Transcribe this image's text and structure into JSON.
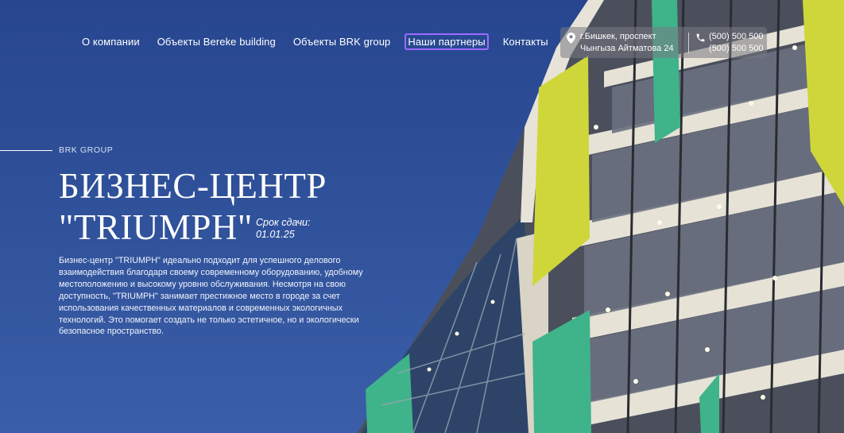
{
  "nav": {
    "items": [
      {
        "label": "О компании"
      },
      {
        "label": "Объекты Bereke building"
      },
      {
        "label": "Объекты BRK group"
      },
      {
        "label": "Наши партнеры"
      },
      {
        "label": "Контакты"
      }
    ],
    "active_index": 3
  },
  "contact": {
    "address_line1": "г.Бишкек, проспект",
    "address_line2": "Чынгыза Айтматова 24",
    "phone1": "(500) 500 500",
    "phone2": "(500) 500 500",
    "address_icon": "map-pin-icon",
    "phone_icon": "phone-icon"
  },
  "hero": {
    "kicker": "BRK GROUP",
    "title_line1": "БИЗНЕС-ЦЕНТР",
    "title_line2": "\"TRIUMPH\"",
    "deadline_label": "Срок сдачи:",
    "deadline_date": "01.01.25",
    "description": "Бизнес-центр \"TRIUMPH\" идеально подходит для успешного делового взаимодействия благодаря своему современному оборудованию, удобному местоположению и высокому уровню обслуживания. Несмотря на свою доступность, \"TRIUMPH\" занимает престижное место в городе за счет использования качественных материалов и современных экологичных технологий. Это помогает создать не только эстетичное, но и экологически безопасное пространство."
  },
  "colors": {
    "sky": "#2f4f96",
    "accent_outline": "#9b6bff",
    "panel_yellow": "#cfd63a",
    "panel_green": "#3fb38a"
  }
}
